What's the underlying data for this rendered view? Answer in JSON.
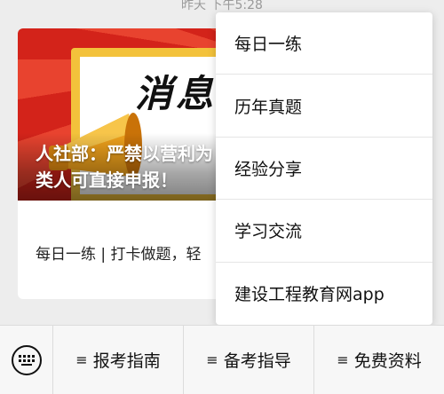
{
  "timestamp": "昨天 下午5:28",
  "article": {
    "banner_title": "消息",
    "headline": "人社部：严禁以营利为目的……类人可直接申报！",
    "headline_line1": "人社部：严禁以营利为",
    "headline_line2": "类人可直接申报！",
    "description": "每日一练 | 打卡做题，轻"
  },
  "popup_menu": {
    "items": [
      {
        "label": "每日一练"
      },
      {
        "label": "历年真题"
      },
      {
        "label": "经验分享"
      },
      {
        "label": "学习交流"
      },
      {
        "label": "建设工程教育网app"
      }
    ]
  },
  "bottom_menu": {
    "keyboard_icon": "keyboard-icon",
    "menu_icon": "≡",
    "items": [
      {
        "label": "报考指南"
      },
      {
        "label": "备考指导"
      },
      {
        "label": "免费资料"
      }
    ]
  },
  "colors": {
    "banner_red": "#d3231a",
    "banner_gold": "#f3c23b",
    "background": "#ededed"
  }
}
